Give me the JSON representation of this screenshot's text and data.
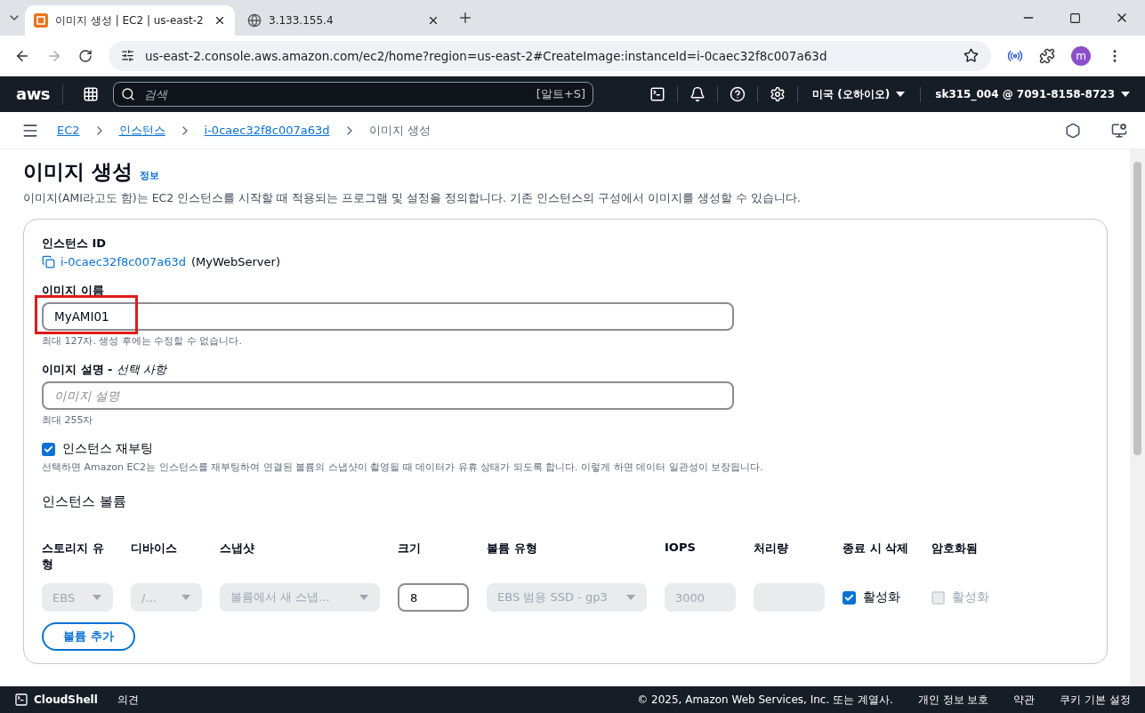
{
  "browser": {
    "tabs": [
      {
        "title": "이미지 생성 | EC2 | us-east-2",
        "kind": "aws",
        "selected": true
      },
      {
        "title": "3.133.155.4",
        "kind": "globe",
        "selected": false
      }
    ],
    "url": "us-east-2.console.aws.amazon.com/ec2/home?region=us-east-2#CreateImage:instanceId=i-0caec32f8c007a63d",
    "profile": "m"
  },
  "aws_nav": {
    "logo": "aws",
    "search_placeholder": "검색",
    "shortcut": "[알트+S]",
    "region": "미국 (오하이오)",
    "account": "sk315_004 @ 7091-8158-8723"
  },
  "breadcrumb": [
    {
      "label": "EC2",
      "kind": "link"
    },
    {
      "label": "인스턴스",
      "kind": "link"
    },
    {
      "label": "i-0caec32f8c007a63d",
      "kind": "link"
    },
    {
      "label": "이미지 생성",
      "kind": "current"
    }
  ],
  "page": {
    "title": "이미지 생성",
    "info": "정보",
    "description": "이미지(AMI라고도 함)는 EC2 인스턴스를 시작할 때 적용되는 프로그램 및 설정을 정의합니다. 기존 인스턴스의 구성에서 이미지를 생성할 수 있습니다."
  },
  "form": {
    "instance_id": {
      "label": "인스턴스 ID",
      "value": "i-0caec32f8c007a63d",
      "name": "(MyWebServer)"
    },
    "image_name": {
      "label": "이미지 이름",
      "value": "MyAMI01",
      "hint": "최대 127자. 생성 후에는 수정할 수 없습니다.",
      "highlighted": true
    },
    "image_description": {
      "label": "이미지 설명 - ",
      "optional": "선택 사항",
      "placeholder": "이미지 설명",
      "hint": "최대 255자"
    },
    "reboot": {
      "label": "인스턴스 재부팅",
      "checked": true,
      "description": "선택하면 Amazon EC2는 인스턴스를 재부팅하여 연결된 볼륨의 스냅샷이 촬영될 때 데이터가 유휴 상태가 되도록 합니다. 이렇게 하면 데이터 일관성이 보장됩니다."
    },
    "volumes": {
      "heading": "인스턴스 볼륨",
      "columns": [
        "스토리지 유형",
        "디바이스",
        "스냅샷",
        "크기",
        "볼륨 유형",
        "IOPS",
        "처리량",
        "종료 시 삭제",
        "암호화됨"
      ],
      "rows": [
        {
          "storage": "EBS",
          "device": "/...",
          "snapshot": "볼륨에서 새 스냅...",
          "size": "8",
          "volume_type": "EBS 범용 SSD - gp3",
          "iops": "3000",
          "delete_on_termination": {
            "label": "활성화",
            "checked": true,
            "disabled": false
          },
          "encrypted": {
            "label": "활성화",
            "checked": false,
            "disabled": true
          }
        }
      ],
      "add_button": "볼륨 추가"
    }
  },
  "footer": {
    "cloudshell": "CloudShell",
    "feedback": "의견",
    "copyright": "© 2025, Amazon Web Services, Inc. 또는 계열사.",
    "links": [
      "개인 정보 보호",
      "약관",
      "쿠키 기본 설정"
    ]
  }
}
